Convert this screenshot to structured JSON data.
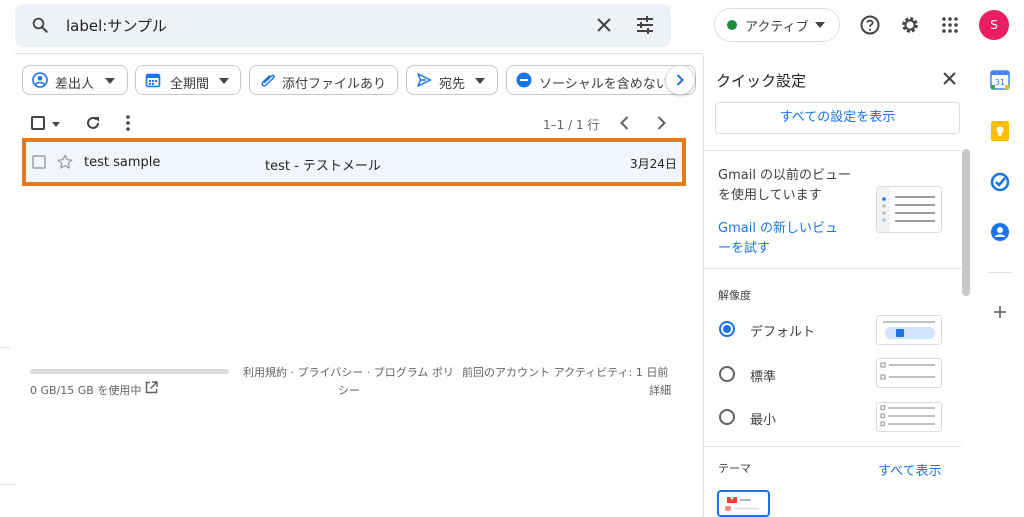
{
  "search": {
    "query": "label:サンプル"
  },
  "header": {
    "status_label": "アクティブ",
    "avatar_initial": "S"
  },
  "colors": {
    "status_dot": "#1e8e3e",
    "avatar_bg": "#e91e63",
    "accent": "#1a73e8",
    "row_highlight": "#e27c1b"
  },
  "chips": [
    {
      "label": "差出人",
      "icon": "person-circle-icon",
      "has_caret": true
    },
    {
      "label": "全期間",
      "icon": "calendar-icon",
      "has_caret": true
    },
    {
      "label": "添付ファイルあり",
      "icon": "attachment-icon",
      "has_caret": false
    },
    {
      "label": "宛先",
      "icon": "send-icon",
      "has_caret": true
    },
    {
      "label": "ソーシャルを含めない",
      "icon": "minus-circle-icon",
      "has_caret": false
    }
  ],
  "toolbar": {
    "pager": "1–1 / 1 行"
  },
  "messages": [
    {
      "sender": "test sample",
      "subject": "test - テストメール",
      "date": "3月24日",
      "starred": false,
      "selected": false
    }
  ],
  "footer": {
    "storage_used_fraction": 0,
    "storage": "0 GB/15 GB を使用中",
    "terms_line1": "利用規約 · プライバシー · プログラム ポリ",
    "terms_line2": "シー",
    "activity_line1": "前回のアカウント アクティビティ: 1 日前",
    "activity_line2": "詳細"
  },
  "quick_settings": {
    "title": "クイック設定",
    "all_settings": "すべての設定を表示",
    "view_text_line1": "Gmail の以前のビュー",
    "view_text_line2": "を使用しています",
    "view_link_line1": "Gmail の新しいビュ",
    "view_link_line2": "ーを試す",
    "density_title": "解像度",
    "density_options": [
      {
        "label": "デフォルト",
        "selected": true
      },
      {
        "label": "標準",
        "selected": false
      },
      {
        "label": "最小",
        "selected": false
      }
    ],
    "theme_title": "テーマ",
    "theme_link": "すべて表示"
  },
  "side_rail": {
    "items": [
      "calendar-icon",
      "keep-icon",
      "tasks-icon",
      "contacts-icon",
      "add-icon"
    ],
    "calendar_day": "31"
  }
}
